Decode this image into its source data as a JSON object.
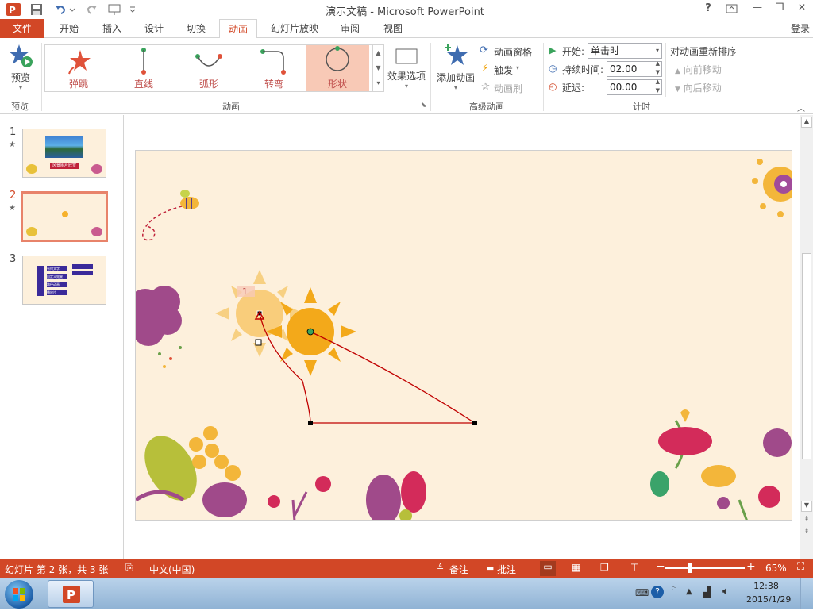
{
  "window": {
    "title": "演示文稿 - Microsoft PowerPoint",
    "controls": {
      "help": "?",
      "minimize": "—",
      "restore": "❐",
      "close": "✕"
    }
  },
  "tabs": [
    {
      "label": "文件",
      "active": false
    },
    {
      "label": "开始"
    },
    {
      "label": "插入"
    },
    {
      "label": "设计"
    },
    {
      "label": "切换"
    },
    {
      "label": "动画",
      "active": true
    },
    {
      "label": "幻灯片放映"
    },
    {
      "label": "审阅"
    },
    {
      "label": "视图"
    }
  ],
  "signin": "登录",
  "ribbon": {
    "preview": {
      "label": "预览",
      "group": "预览"
    },
    "gallery": {
      "group": "动画",
      "items": [
        {
          "label": "弹跳",
          "icon": "bounce-star-icon"
        },
        {
          "label": "直线",
          "icon": "line-path-icon"
        },
        {
          "label": "弧形",
          "icon": "arc-path-icon"
        },
        {
          "label": "转弯",
          "icon": "turn-path-icon"
        },
        {
          "label": "形状",
          "icon": "shape-path-icon",
          "selected": true
        }
      ]
    },
    "effect_options": "效果选项",
    "advanced": {
      "group": "高级动画",
      "add": "添加动画",
      "pane": "动画窗格",
      "trigger": "触发",
      "painter": "动画刷"
    },
    "timing": {
      "group": "计时",
      "start_label": "开始:",
      "start_value": "单击时",
      "duration_label": "持续时间:",
      "duration_value": "02.00",
      "delay_label": "延迟:",
      "delay_value": "00.00",
      "reorder_title": "对动画重新排序",
      "move_earlier": "向前移动",
      "move_later": "向后移动"
    }
  },
  "slides": [
    {
      "number": "1",
      "star": "★",
      "caption": "风景图片欣赏"
    },
    {
      "number": "2",
      "star": "★",
      "selected": true
    },
    {
      "number": "3",
      "items": [
        "有何文字",
        "自定义效果",
        "路径动画",
        "播放片"
      ]
    }
  ],
  "slide_canvas": {
    "anim_tag": "1"
  },
  "status": {
    "slide_info": "幻灯片 第 2 张，共 3 张",
    "language": "中文(中国)",
    "notes": "备注",
    "comments": "批注",
    "zoom": "65%",
    "zoom_level": 0.65
  },
  "taskbar": {
    "time": "12:38",
    "date": "2015/1/29"
  },
  "colors": {
    "accent": "#d24726",
    "slide_bg": "#fdf0dc",
    "selected_gallery": "#f8c9b6",
    "sun": "#f6b12c",
    "path": "#c00000"
  }
}
